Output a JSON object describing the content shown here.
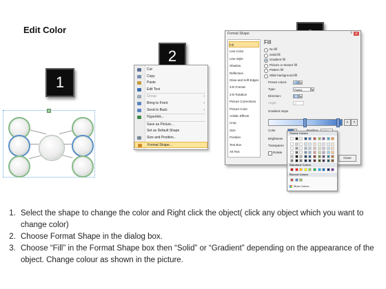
{
  "title": "Edit Color",
  "steps": {
    "one": "1",
    "two": "2",
    "three": "3"
  },
  "context_menu": {
    "items": [
      {
        "label": "Cut",
        "icon": "scissors-icon",
        "color": "#5a6e96",
        "disabled": false,
        "submenu": false
      },
      {
        "label": "Copy",
        "icon": "copy-icon",
        "color": "#7a8fb0",
        "disabled": false,
        "submenu": false
      },
      {
        "label": "Paste",
        "icon": "paste-icon",
        "color": "#c79a3a",
        "disabled": false,
        "submenu": false
      },
      {
        "label": "Edit Text",
        "icon": "edit-text-icon",
        "color": "#3b6db3",
        "disabled": false,
        "submenu": false
      },
      {
        "label": "Group",
        "icon": "group-icon",
        "color": "#9da9b8",
        "disabled": true,
        "submenu": true
      },
      {
        "label": "Bring to Front",
        "icon": "bring-front-icon",
        "color": "#5a84c0",
        "disabled": false,
        "submenu": true
      },
      {
        "label": "Send to Back",
        "icon": "send-back-icon",
        "color": "#5a84c0",
        "disabled": false,
        "submenu": true
      },
      {
        "label": "Hyperlink...",
        "icon": "hyperlink-icon",
        "color": "#3f8a48",
        "disabled": false,
        "submenu": false
      },
      {
        "label": "Save as Picture...",
        "icon": "",
        "color": "",
        "disabled": false,
        "submenu": false
      },
      {
        "label": "Set as Default Shape",
        "icon": "",
        "color": "",
        "disabled": false,
        "submenu": false
      },
      {
        "label": "Size and Position...",
        "icon": "size-position-icon",
        "color": "#7b8898",
        "disabled": false,
        "submenu": false
      },
      {
        "label": "Format Shape...",
        "icon": "format-shape-icon",
        "color": "#d08b2a",
        "disabled": false,
        "submenu": false,
        "highlight": true
      }
    ]
  },
  "dialog": {
    "title": "Format Shape",
    "help": "?",
    "close": "x",
    "categories": [
      "Fill",
      "Line Color",
      "Line Style",
      "Shadow",
      "Reflection",
      "Glow and Soft Edges",
      "3-D Format",
      "3-D Rotation",
      "Picture Corrections",
      "Picture Color",
      "Artistic Effects",
      "Crop",
      "Size",
      "Position",
      "Text Box",
      "Alt Text"
    ],
    "fill_heading": "Fill",
    "fill_options": [
      {
        "label": "No fill",
        "selected": false
      },
      {
        "label": "Solid fill",
        "selected": false
      },
      {
        "label": "Gradient fill",
        "selected": true
      },
      {
        "label": "Picture or texture fill",
        "selected": false
      },
      {
        "label": "Pattern fill",
        "selected": false
      },
      {
        "label": "Slide background fill",
        "selected": false
      }
    ],
    "preset_colors": "Preset colors:",
    "type_label": "Type:",
    "type_value": "Radial",
    "direction_label": "Direction:",
    "angle_label": "Angle:",
    "angle_value": "0°",
    "gradient_stops_label": "Gradient stops",
    "color_label": "Color",
    "position_label": "Position:",
    "position_value": "100%",
    "brightness_label": "Brightness",
    "transparency_label": "Transparen",
    "rotate_label": "Rotate",
    "close_button": "Close",
    "accent_color": "#fbe29a"
  },
  "palette": {
    "theme_colors": "Theme Colors",
    "standard_colors": "Standard Colors",
    "recent_colors": "Recent Colors",
    "more_colors": "More Colors...",
    "theme_row": [
      "#ffffff",
      "#000000",
      "#eeece1",
      "#1f497d",
      "#4f81bd",
      "#c0504d",
      "#9bbb59",
      "#8064a2",
      "#4bacc6",
      "#f79646"
    ],
    "standard_row": [
      "#c00000",
      "#ff0000",
      "#ffc000",
      "#ffff00",
      "#92d050",
      "#00b050",
      "#00b0f0",
      "#0070c0",
      "#002060",
      "#7030a0"
    ],
    "recent_row": [
      "#c0504d",
      "#4f81bd",
      "#9bbb59"
    ]
  },
  "instructions": [
    "Select the shape to change the color and Right click the object( click any object which you want to change color)",
    "Choose Format Shape in the dialog box.",
    "Choose “Fill” in the Format Shape box then “Solid” or “Gradient” depending on the appearance of the object. Change colour as shown in the picture."
  ]
}
